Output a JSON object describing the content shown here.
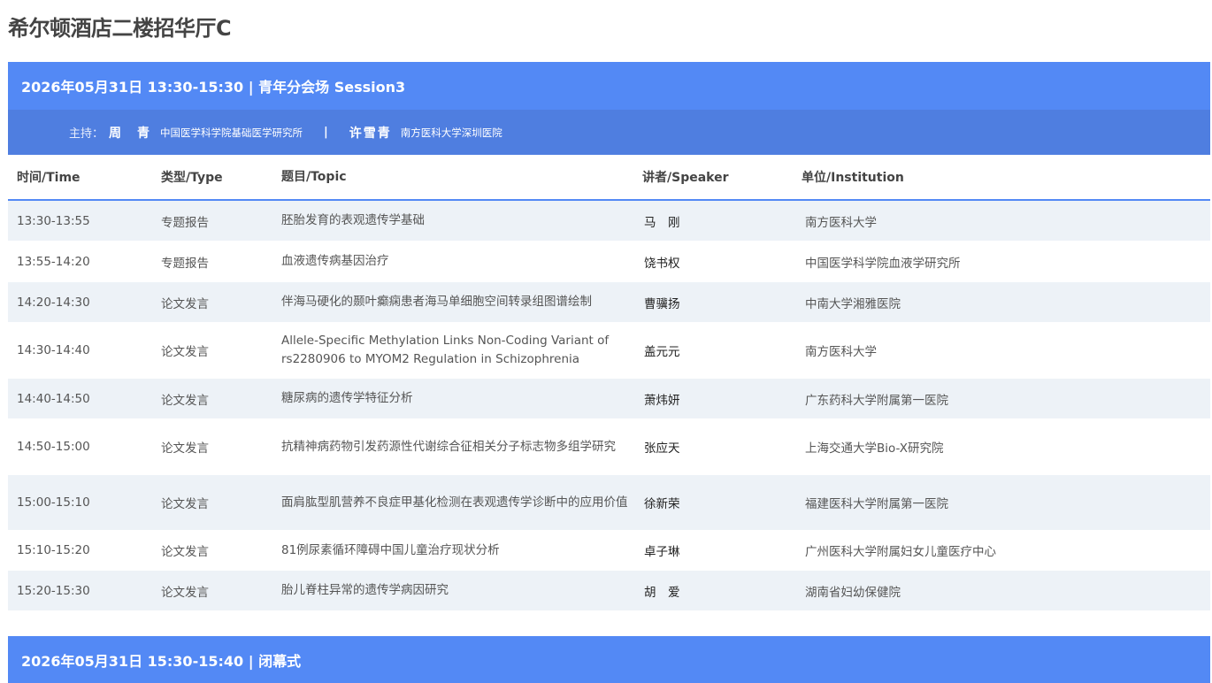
{
  "page": {
    "title": "希尔顿酒店二楼招华厅C"
  },
  "sessions": [
    {
      "header": "2026年05月31日 13:30-15:30 | 青年分会场 Session3",
      "host_label": "主持：",
      "hosts": [
        {
          "name": "周　青",
          "institution": "中国医学科学院基础医学研究所"
        },
        {
          "name": "许雪青",
          "institution": "南方医科大学深圳医院"
        }
      ],
      "separator": "|",
      "columns": {
        "time": "时间/Time",
        "type": "类型/Type",
        "topic": "题目/Topic",
        "speaker": "讲者/Speaker",
        "institution": "单位/Institution"
      },
      "rows": [
        {
          "time": "13:30-13:55",
          "type": "专题报告",
          "topic": "胚胎发育的表观遗传学基础",
          "speaker": "马　刚",
          "institution": "南方医科大学"
        },
        {
          "time": "13:55-14:20",
          "type": "专题报告",
          "topic": "血液遗传病基因治疗",
          "speaker": "饶书权",
          "institution": "中国医学科学院血液学研究所"
        },
        {
          "time": "14:20-14:30",
          "type": "论文发言",
          "topic": "伴海马硬化的颞叶癫痫患者海马单细胞空间转录组图谱绘制",
          "speaker": "曹骥扬",
          "institution": "中南大学湘雅医院"
        },
        {
          "time": "14:30-14:40",
          "type": "论文发言",
          "topic": "Allele-Specific Methylation Links Non-Coding Variant of rs2280906 to MYOM2 Regulation in Schizophrenia",
          "speaker": "盖元元",
          "institution": "南方医科大学"
        },
        {
          "time": "14:40-14:50",
          "type": "论文发言",
          "topic": "糖尿病的遗传学特征分析",
          "speaker": "萧炜妍",
          "institution": "广东药科大学附属第一医院"
        },
        {
          "time": "14:50-15:00",
          "type": "论文发言",
          "topic": "抗精神病药物引发药源性代谢综合征相关分子标志物多组学研究",
          "speaker": "张应天",
          "institution": "上海交通大学Bio-X研究院"
        },
        {
          "time": "15:00-15:10",
          "type": "论文发言",
          "topic": "面肩肱型肌营养不良症甲基化检测在表观遗传学诊断中的应用价值",
          "speaker": "徐新荣",
          "institution": "福建医科大学附属第一医院"
        },
        {
          "time": "15:10-15:20",
          "type": "论文发言",
          "topic": "81例尿素循环障碍中国儿童治疗现状分析",
          "speaker": "卓子琳",
          "institution": "广州医科大学附属妇女儿童医疗中心"
        },
        {
          "time": "15:20-15:30",
          "type": "论文发言",
          "topic": "胎儿脊柱异常的遗传学病因研究",
          "speaker": "胡　爱",
          "institution": "湖南省妇幼保健院"
        }
      ]
    },
    {
      "header": "2026年05月31日 15:30-15:40 | 闭幕式"
    }
  ],
  "colors": {
    "header_bg": "#5389f5",
    "host_bg": "#4f7ee0",
    "alt_row_bg": "#edf2f7"
  }
}
